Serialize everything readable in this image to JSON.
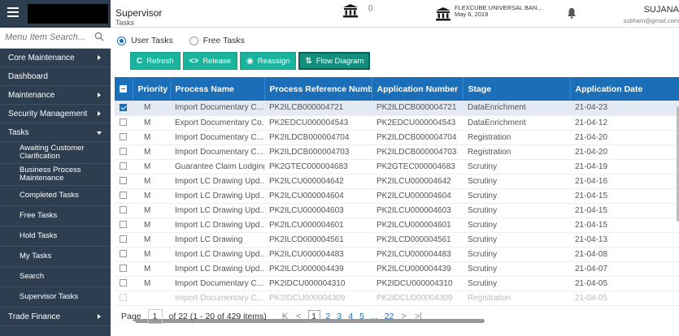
{
  "sidebar": {
    "search_placeholder": "Menu Item Search...",
    "items": [
      {
        "label": "Core Maintenance"
      },
      {
        "label": "Dashboard"
      },
      {
        "label": "Maintenance"
      },
      {
        "label": "Security Management"
      },
      {
        "label": "Tasks"
      }
    ],
    "tasks_sub": [
      {
        "label": "Awaiting Customer Clarification"
      },
      {
        "label": "Business Process Maintenance"
      },
      {
        "label": "Completed Tasks"
      },
      {
        "label": "Free Tasks"
      },
      {
        "label": "Hold Tasks"
      },
      {
        "label": "My Tasks"
      },
      {
        "label": "Search"
      },
      {
        "label": "Supervisor Tasks"
      }
    ],
    "bottom_item": "Trade Finance"
  },
  "header": {
    "title": "Supervisor",
    "subtitle": "Tasks",
    "paren": "()",
    "bank_name": "FLEXCUBE UNIVERSAL BAN...",
    "bank_date": "May 6, 2019",
    "user": "SUJANA",
    "email": "subham@gmail.com"
  },
  "tabs": {
    "user_tasks": "User Tasks",
    "free_tasks": "Free Tasks"
  },
  "toolbar": {
    "refresh": "Refresh",
    "release": "Release",
    "reassign": "Reassign",
    "flow_diagram": "Flow Diagram"
  },
  "table": {
    "columns": [
      "Priority",
      "Process Name",
      "Process Reference Number",
      "Application Number",
      "Stage",
      "Application Date"
    ],
    "rows": [
      {
        "checked": true,
        "priority": "M",
        "process": "Import Documentary C...",
        "ref": "PK2ILCB000004721",
        "app": "PK2ILDCB000004721",
        "stage": "DataEnrichment",
        "date": "21-04-23"
      },
      {
        "checked": false,
        "priority": "M",
        "process": "Export Documentary Co...",
        "ref": "PK2EDCU000004543",
        "app": "PK2EDCU000004543",
        "stage": "DataEnrichment",
        "date": "21-04-12"
      },
      {
        "checked": false,
        "priority": "M",
        "process": "Import Documentary C...",
        "ref": "PK2ILDCB000004704",
        "app": "PK2ILDCB000004704",
        "stage": "Registration",
        "date": "21-04-20"
      },
      {
        "checked": false,
        "priority": "M",
        "process": "Import Documentary C...",
        "ref": "PK2ILDCB000004703",
        "app": "PK2ILDCB000004703",
        "stage": "Registration",
        "date": "21-04-20"
      },
      {
        "checked": false,
        "priority": "M",
        "process": "Guarantee Claim Lodging",
        "ref": "PK2GTEC000004683",
        "app": "PK2GTEC000004683",
        "stage": "Scrutiny",
        "date": "21-04-19"
      },
      {
        "checked": false,
        "priority": "M",
        "process": "Import LC Drawing Upd...",
        "ref": "PK2ILCU000004642",
        "app": "PK2ILCU000004642",
        "stage": "Scrutiny",
        "date": "21-04-16"
      },
      {
        "checked": false,
        "priority": "M",
        "process": "Import LC Drawing Upd...",
        "ref": "PK2ILCU000004604",
        "app": "PK2ILCU000004604",
        "stage": "Scrutiny",
        "date": "21-04-15"
      },
      {
        "checked": false,
        "priority": "M",
        "process": "Import LC Drawing Upd...",
        "ref": "PK2ILCU000004603",
        "app": "PK2ILCU000004603",
        "stage": "Scrutiny",
        "date": "21-04-15"
      },
      {
        "checked": false,
        "priority": "M",
        "process": "Import LC Drawing Upd...",
        "ref": "PK2ILCU000004601",
        "app": "PK2ILCU000004601",
        "stage": "Scrutiny",
        "date": "21-04-15"
      },
      {
        "checked": false,
        "priority": "M",
        "process": "Import LC Drawing",
        "ref": "PK2ILCD000004561",
        "app": "PK2ILCD000004561",
        "stage": "Scrutiny",
        "date": "21-04-13"
      },
      {
        "checked": false,
        "priority": "M",
        "process": "Import LC Drawing Upd...",
        "ref": "PK2ILCU000004483",
        "app": "PK2ILCU000004483",
        "stage": "Scrutiny",
        "date": "21-04-08"
      },
      {
        "checked": false,
        "priority": "M",
        "process": "Import LC Drawing Upd...",
        "ref": "PK2ILCU000004439",
        "app": "PK2ILCU000004439",
        "stage": "Scrutiny",
        "date": "21-04-07"
      },
      {
        "checked": false,
        "priority": "M",
        "process": "Import Documentary C...",
        "ref": "PK2IDCU000004310",
        "app": "PK2IDCU000004310",
        "stage": "Scrutiny",
        "date": "21-04-05"
      },
      {
        "checked": false,
        "priority": "",
        "process": "Import Documentary C...",
        "ref": "PK2IDCU000004309",
        "app": "PK2IDCU000004309",
        "stage": "Registration",
        "date": "21-04-05"
      }
    ]
  },
  "pager": {
    "page_label": "Page",
    "page_value": "1",
    "summary": "of 22  (1 - 20 of 429 items)",
    "first": "K",
    "prev": "<",
    "current": "1",
    "pages": [
      "2",
      "3",
      "4",
      "5"
    ],
    "ellipsis": "...",
    "last_page": "22",
    "next": ">",
    "last": ">|"
  }
}
